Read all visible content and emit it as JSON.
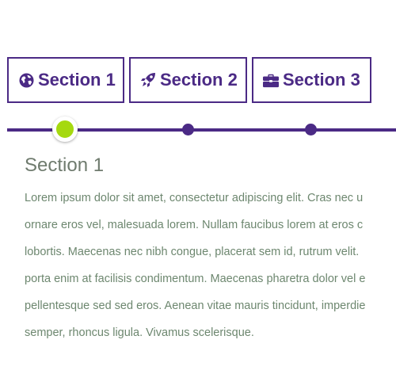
{
  "tabs": [
    {
      "label": "Section 1",
      "icon": "globe-icon"
    },
    {
      "label": "Section 2",
      "icon": "rocket-icon"
    },
    {
      "label": "Section 3",
      "icon": "briefcase-icon"
    }
  ],
  "timeline": {
    "active_index": 0,
    "colors": {
      "line": "#4b2a85",
      "active": "#a5d90f",
      "inactive": "#4b2a85"
    }
  },
  "content": {
    "title": "Section 1",
    "lines": [
      "Lorem ipsum dolor sit amet, consectetur adipiscing elit. Cras nec u",
      "ornare eros vel, malesuada lorem. Nullam faucibus lorem at eros c",
      "lobortis. Maecenas nec nibh congue, placerat sem id, rutrum velit.",
      "porta enim at facilisis condimentum. Maecenas pharetra dolor vel e",
      "pellentesque sed sed eros. Aenean vitae mauris tincidunt, imperdie",
      "semper, rhoncus ligula. Vivamus scelerisque."
    ]
  }
}
